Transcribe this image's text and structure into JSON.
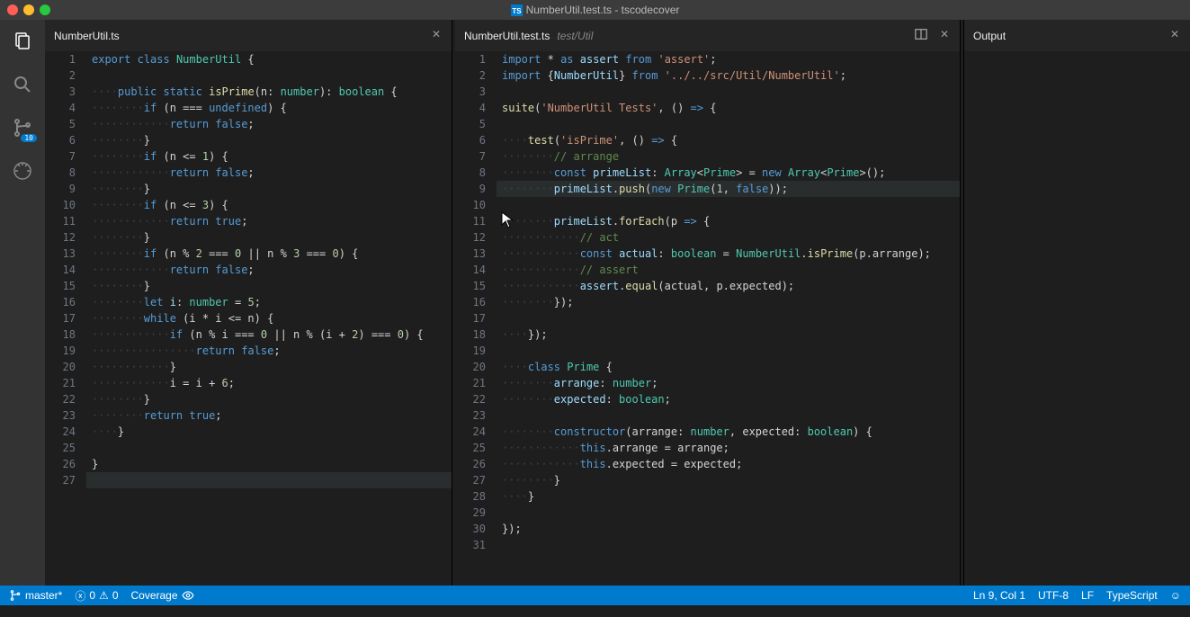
{
  "window": {
    "title": "NumberUtil.test.ts - tscodecover"
  },
  "activity": {
    "git_badge": "10"
  },
  "tabs": {
    "left": {
      "file": "NumberUtil.ts"
    },
    "right": {
      "file": "NumberUtil.test.ts",
      "path": "test/Util"
    },
    "output": {
      "title": "Output"
    }
  },
  "left_code": [
    [
      [
        "kw",
        "export"
      ],
      [
        "op",
        " "
      ],
      [
        "kw",
        "class"
      ],
      [
        "op",
        " "
      ],
      [
        "type",
        "NumberUtil"
      ],
      [
        "op",
        " {"
      ]
    ],
    [],
    [
      [
        "ws",
        "····"
      ],
      [
        "kw",
        "public"
      ],
      [
        "op",
        " "
      ],
      [
        "kw",
        "static"
      ],
      [
        "op",
        " "
      ],
      [
        "fn",
        "isPrime"
      ],
      [
        "op",
        "(n: "
      ],
      [
        "type",
        "number"
      ],
      [
        "op",
        "): "
      ],
      [
        "type",
        "boolean"
      ],
      [
        "op",
        " {"
      ]
    ],
    [
      [
        "ws",
        "········"
      ],
      [
        "kw",
        "if"
      ],
      [
        "op",
        " (n "
      ],
      [
        "op",
        "==="
      ],
      [
        "op",
        " "
      ],
      [
        "kw",
        "undefined"
      ],
      [
        "op",
        ") {"
      ]
    ],
    [
      [
        "ws",
        "············"
      ],
      [
        "kw",
        "return"
      ],
      [
        "op",
        " "
      ],
      [
        "kw",
        "false"
      ],
      [
        "op",
        ";"
      ]
    ],
    [
      [
        "ws",
        "········"
      ],
      [
        "op",
        "}"
      ]
    ],
    [
      [
        "ws",
        "········"
      ],
      [
        "kw",
        "if"
      ],
      [
        "op",
        " (n "
      ],
      [
        "op",
        "<="
      ],
      [
        "op",
        " "
      ],
      [
        "num",
        "1"
      ],
      [
        "op",
        ") {"
      ]
    ],
    [
      [
        "ws",
        "············"
      ],
      [
        "kw",
        "return"
      ],
      [
        "op",
        " "
      ],
      [
        "kw",
        "false"
      ],
      [
        "op",
        ";"
      ]
    ],
    [
      [
        "ws",
        "········"
      ],
      [
        "op",
        "}"
      ]
    ],
    [
      [
        "ws",
        "········"
      ],
      [
        "kw",
        "if"
      ],
      [
        "op",
        " (n "
      ],
      [
        "op",
        "<="
      ],
      [
        "op",
        " "
      ],
      [
        "num",
        "3"
      ],
      [
        "op",
        ") {"
      ]
    ],
    [
      [
        "ws",
        "············"
      ],
      [
        "kw",
        "return"
      ],
      [
        "op",
        " "
      ],
      [
        "kw",
        "true"
      ],
      [
        "op",
        ";"
      ]
    ],
    [
      [
        "ws",
        "········"
      ],
      [
        "op",
        "}"
      ]
    ],
    [
      [
        "ws",
        "········"
      ],
      [
        "kw",
        "if"
      ],
      [
        "op",
        " (n "
      ],
      [
        "op",
        "%"
      ],
      [
        "op",
        " "
      ],
      [
        "num",
        "2"
      ],
      [
        "op",
        " "
      ],
      [
        "op",
        "==="
      ],
      [
        "op",
        " "
      ],
      [
        "num",
        "0"
      ],
      [
        "op",
        " "
      ],
      [
        "op",
        "||"
      ],
      [
        "op",
        " n "
      ],
      [
        "op",
        "%"
      ],
      [
        "op",
        " "
      ],
      [
        "num",
        "3"
      ],
      [
        "op",
        " "
      ],
      [
        "op",
        "==="
      ],
      [
        "op",
        " "
      ],
      [
        "num",
        "0"
      ],
      [
        "op",
        ") {"
      ]
    ],
    [
      [
        "ws",
        "············"
      ],
      [
        "kw",
        "return"
      ],
      [
        "op",
        " "
      ],
      [
        "kw",
        "false"
      ],
      [
        "op",
        ";"
      ]
    ],
    [
      [
        "ws",
        "········"
      ],
      [
        "op",
        "}"
      ]
    ],
    [
      [
        "ws",
        "········"
      ],
      [
        "kw",
        "let"
      ],
      [
        "op",
        " "
      ],
      [
        "ident",
        "i"
      ],
      [
        "op",
        ": "
      ],
      [
        "type",
        "number"
      ],
      [
        "op",
        " = "
      ],
      [
        "num",
        "5"
      ],
      [
        "op",
        ";"
      ]
    ],
    [
      [
        "ws",
        "········"
      ],
      [
        "kw",
        "while"
      ],
      [
        "op",
        " (i "
      ],
      [
        "op",
        "*"
      ],
      [
        "op",
        " i "
      ],
      [
        "op",
        "<="
      ],
      [
        "op",
        " n) {"
      ]
    ],
    [
      [
        "ws",
        "············"
      ],
      [
        "kw",
        "if"
      ],
      [
        "op",
        " (n "
      ],
      [
        "op",
        "%"
      ],
      [
        "op",
        " i "
      ],
      [
        "op",
        "==="
      ],
      [
        "op",
        " "
      ],
      [
        "num",
        "0"
      ],
      [
        "op",
        " "
      ],
      [
        "op",
        "||"
      ],
      [
        "op",
        " n "
      ],
      [
        "op",
        "%"
      ],
      [
        "op",
        " (i "
      ],
      [
        "op",
        "+"
      ],
      [
        "op",
        " "
      ],
      [
        "num",
        "2"
      ],
      [
        "op",
        ") "
      ],
      [
        "op",
        "==="
      ],
      [
        "op",
        " "
      ],
      [
        "num",
        "0"
      ],
      [
        "op",
        ") {"
      ]
    ],
    [
      [
        "ws",
        "················"
      ],
      [
        "kw",
        "return"
      ],
      [
        "op",
        " "
      ],
      [
        "kw",
        "false"
      ],
      [
        "op",
        ";"
      ]
    ],
    [
      [
        "ws",
        "············"
      ],
      [
        "op",
        "}"
      ]
    ],
    [
      [
        "ws",
        "············"
      ],
      [
        "op",
        "i = i "
      ],
      [
        "op",
        "+"
      ],
      [
        "op",
        " "
      ],
      [
        "num",
        "6"
      ],
      [
        "op",
        ";"
      ]
    ],
    [
      [
        "ws",
        "········"
      ],
      [
        "op",
        "}"
      ]
    ],
    [
      [
        "ws",
        "········"
      ],
      [
        "kw",
        "return"
      ],
      [
        "op",
        " "
      ],
      [
        "kw",
        "true"
      ],
      [
        "op",
        ";"
      ]
    ],
    [
      [
        "ws",
        "····"
      ],
      [
        "op",
        "}"
      ]
    ],
    [],
    [
      [
        "op",
        "}"
      ]
    ],
    []
  ],
  "right_code": [
    [
      [
        "kw",
        "import"
      ],
      [
        "op",
        " "
      ],
      [
        "op",
        "*"
      ],
      [
        "op",
        " "
      ],
      [
        "kw",
        "as"
      ],
      [
        "op",
        " "
      ],
      [
        "ident",
        "assert"
      ],
      [
        "op",
        " "
      ],
      [
        "kw",
        "from"
      ],
      [
        "op",
        " "
      ],
      [
        "str",
        "'assert'"
      ],
      [
        "op",
        ";"
      ]
    ],
    [
      [
        "kw",
        "import"
      ],
      [
        "op",
        " {"
      ],
      [
        "ident",
        "NumberUtil"
      ],
      [
        "op",
        "} "
      ],
      [
        "kw",
        "from"
      ],
      [
        "op",
        " "
      ],
      [
        "str",
        "'../../src/Util/NumberUtil'"
      ],
      [
        "op",
        ";"
      ]
    ],
    [],
    [
      [
        "fn",
        "suite"
      ],
      [
        "op",
        "("
      ],
      [
        "str",
        "'NumberUtil Tests'"
      ],
      [
        "op",
        ", () "
      ],
      [
        "kw",
        "=>"
      ],
      [
        "op",
        " {"
      ]
    ],
    [],
    [
      [
        "ws",
        "····"
      ],
      [
        "fn",
        "test"
      ],
      [
        "op",
        "("
      ],
      [
        "str",
        "'isPrime'"
      ],
      [
        "op",
        ", () "
      ],
      [
        "kw",
        "=>"
      ],
      [
        "op",
        " {"
      ]
    ],
    [
      [
        "ws",
        "········"
      ],
      [
        "cmt",
        "// arrange"
      ]
    ],
    [
      [
        "ws",
        "········"
      ],
      [
        "kw",
        "const"
      ],
      [
        "op",
        " "
      ],
      [
        "ident",
        "primeList"
      ],
      [
        "op",
        ": "
      ],
      [
        "type",
        "Array"
      ],
      [
        "op",
        "<"
      ],
      [
        "type",
        "Prime"
      ],
      [
        "op",
        "> = "
      ],
      [
        "kw",
        "new"
      ],
      [
        "op",
        " "
      ],
      [
        "type",
        "Array"
      ],
      [
        "op",
        "<"
      ],
      [
        "type",
        "Prime"
      ],
      [
        "op",
        ">();"
      ]
    ],
    [
      [
        "ws",
        "········"
      ],
      [
        "ident",
        "primeList"
      ],
      [
        "op",
        "."
      ],
      [
        "fn",
        "push"
      ],
      [
        "op",
        "("
      ],
      [
        "kw",
        "new"
      ],
      [
        "op",
        " "
      ],
      [
        "type",
        "Prime"
      ],
      [
        "op",
        "("
      ],
      [
        "num",
        "1"
      ],
      [
        "op",
        ", "
      ],
      [
        "kw",
        "false"
      ],
      [
        "op",
        "));"
      ]
    ],
    [],
    [
      [
        "ws",
        "········"
      ],
      [
        "ident",
        "primeList"
      ],
      [
        "op",
        "."
      ],
      [
        "fn",
        "forEach"
      ],
      [
        "op",
        "(p "
      ],
      [
        "kw",
        "=>"
      ],
      [
        "op",
        " {"
      ]
    ],
    [
      [
        "ws",
        "············"
      ],
      [
        "cmt",
        "// act"
      ]
    ],
    [
      [
        "ws",
        "············"
      ],
      [
        "kw",
        "const"
      ],
      [
        "op",
        " "
      ],
      [
        "ident",
        "actual"
      ],
      [
        "op",
        ": "
      ],
      [
        "type",
        "boolean"
      ],
      [
        "op",
        " = "
      ],
      [
        "type",
        "NumberUtil"
      ],
      [
        "op",
        "."
      ],
      [
        "fn",
        "isPrime"
      ],
      [
        "op",
        "(p.arrange);"
      ]
    ],
    [
      [
        "ws",
        "············"
      ],
      [
        "cmt",
        "// assert"
      ]
    ],
    [
      [
        "ws",
        "············"
      ],
      [
        "ident",
        "assert"
      ],
      [
        "op",
        "."
      ],
      [
        "fn",
        "equal"
      ],
      [
        "op",
        "(actual, p.expected);"
      ]
    ],
    [
      [
        "ws",
        "········"
      ],
      [
        "op",
        "});"
      ]
    ],
    [],
    [
      [
        "ws",
        "····"
      ],
      [
        "op",
        "});"
      ]
    ],
    [],
    [
      [
        "ws",
        "····"
      ],
      [
        "kw",
        "class"
      ],
      [
        "op",
        " "
      ],
      [
        "type",
        "Prime"
      ],
      [
        "op",
        " {"
      ]
    ],
    [
      [
        "ws",
        "········"
      ],
      [
        "ident",
        "arrange"
      ],
      [
        "op",
        ": "
      ],
      [
        "type",
        "number"
      ],
      [
        "op",
        ";"
      ]
    ],
    [
      [
        "ws",
        "········"
      ],
      [
        "ident",
        "expected"
      ],
      [
        "op",
        ": "
      ],
      [
        "type",
        "boolean"
      ],
      [
        "op",
        ";"
      ]
    ],
    [],
    [
      [
        "ws",
        "········"
      ],
      [
        "kw",
        "constructor"
      ],
      [
        "op",
        "(arrange: "
      ],
      [
        "type",
        "number"
      ],
      [
        "op",
        ", expected: "
      ],
      [
        "type",
        "boolean"
      ],
      [
        "op",
        ") {"
      ]
    ],
    [
      [
        "ws",
        "············"
      ],
      [
        "kw",
        "this"
      ],
      [
        "op",
        ".arrange = arrange;"
      ]
    ],
    [
      [
        "ws",
        "············"
      ],
      [
        "kw",
        "this"
      ],
      [
        "op",
        ".expected = expected;"
      ]
    ],
    [
      [
        "ws",
        "········"
      ],
      [
        "op",
        "}"
      ]
    ],
    [
      [
        "ws",
        "····"
      ],
      [
        "op",
        "}"
      ]
    ],
    [],
    [
      [
        "op",
        "});"
      ]
    ],
    []
  ],
  "right_highlight": 9,
  "left_highlight": 27,
  "status": {
    "branch": "master*",
    "errors": "0",
    "warnings": "0",
    "coverage": "Coverage",
    "pos": "Ln 9, Col 1",
    "encoding": "UTF-8",
    "eol": "LF",
    "lang": "TypeScript"
  }
}
